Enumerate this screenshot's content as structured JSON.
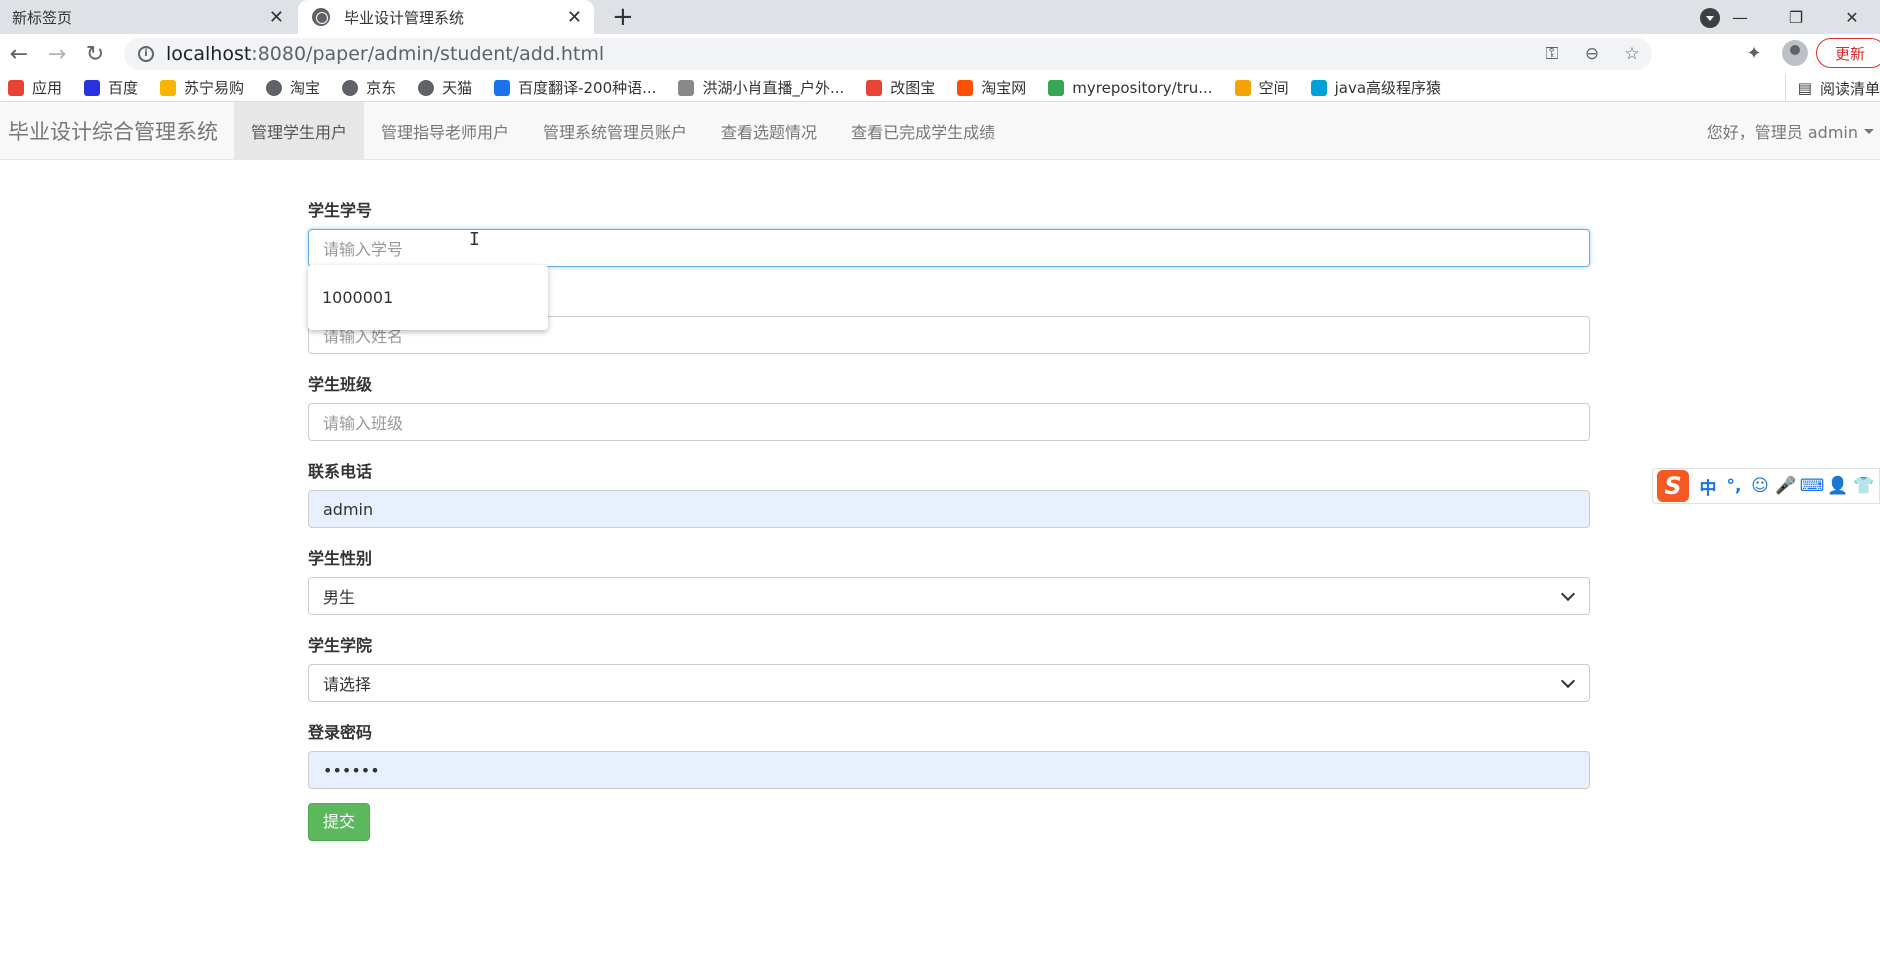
{
  "browser": {
    "tabs": [
      {
        "title": "新标签页"
      },
      {
        "title": "毕业设计管理系统"
      }
    ],
    "url_host": "localhost",
    "url_path": ":8080/paper/admin/student/add.html",
    "update_label": "更新",
    "bookmarks": [
      {
        "label": "应用",
        "icon": "apps-grid-icon",
        "color": "#ea4335"
      },
      {
        "label": "百度",
        "icon": "baidu-paw-icon",
        "color": "#2932e1"
      },
      {
        "label": "苏宁易购",
        "icon": "suning-icon",
        "color": "#f7b500"
      },
      {
        "label": "淘宝",
        "icon": "globe-icon",
        "color": "#5f6368"
      },
      {
        "label": "京东",
        "icon": "globe-icon",
        "color": "#5f6368"
      },
      {
        "label": "天猫",
        "icon": "globe-icon",
        "color": "#5f6368"
      },
      {
        "label": "百度翻译-200种语...",
        "icon": "baidu-translate-icon",
        "color": "#1a73e8"
      },
      {
        "label": "洪湖小肖直播_户外...",
        "icon": "bird-icon",
        "color": "#888888"
      },
      {
        "label": "改图宝",
        "icon": "gaitubao-icon",
        "color": "#ea4335"
      },
      {
        "label": "淘宝网",
        "icon": "taobao-icon",
        "color": "#ff5000"
      },
      {
        "label": "myrepository/tru...",
        "icon": "chrome-icon",
        "color": "#34a853"
      },
      {
        "label": "空间",
        "icon": "qzone-icon",
        "color": "#f4a300"
      },
      {
        "label": "java高级程序猿",
        "icon": "bilibili-icon",
        "color": "#00a1d6"
      }
    ],
    "reading_list": "阅读清单"
  },
  "navbar": {
    "brand": "毕业设计综合管理系统",
    "items": [
      {
        "label": "管理学生用户",
        "active": true
      },
      {
        "label": "管理指导老师用户",
        "active": false
      },
      {
        "label": "管理系统管理员账户",
        "active": false
      },
      {
        "label": "查看选题情况",
        "active": false
      },
      {
        "label": "查看已完成学生成绩",
        "active": false
      }
    ],
    "user": "您好，管理员 admin"
  },
  "form": {
    "student_id": {
      "label": "学生学号",
      "placeholder": "请输入学号"
    },
    "name": {
      "placeholder": "请输入姓名"
    },
    "class": {
      "label": "学生班级",
      "placeholder": "请输入班级"
    },
    "phone": {
      "label": "联系电话",
      "value": "admin"
    },
    "gender": {
      "label": "学生性别",
      "value": "男生"
    },
    "college": {
      "label": "学生学院",
      "value": "请选择"
    },
    "password": {
      "label": "登录密码",
      "value": "••••••"
    },
    "submit": "提交",
    "autocomplete": "1000001"
  },
  "ime": {
    "items": [
      "中",
      "°,",
      "☺",
      "🎤",
      "⌨",
      "👤",
      "👕"
    ]
  }
}
